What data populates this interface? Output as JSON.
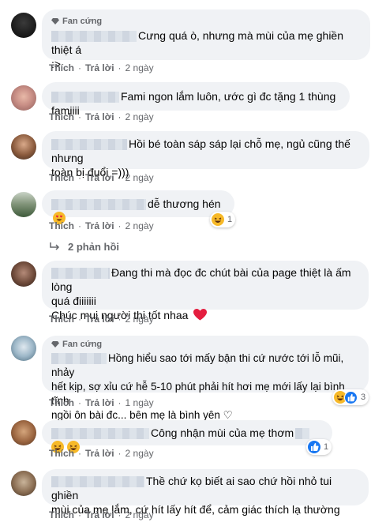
{
  "comments": [
    {
      "badge": "Fan cứng",
      "text_line1": "Cưng quá ò, nhưng mà mùi của mẹ ghiền thiệt á",
      "text_line2": ":>",
      "like": "Thích",
      "reply": "Trả lời",
      "time": "2 ngày"
    },
    {
      "text_line1": "Fami ngon lắm luôn, ước gì đc tặng 1 thùng famiiii",
      "like": "Thích",
      "reply": "Trả lời",
      "time": "2 ngày"
    },
    {
      "text_line1": "Hồi bé toàn sáp sáp lại chỗ mẹ, ngủ cũng thế nhưng",
      "text_line2": "toàn bị đuổi =)))",
      "like": "Thích",
      "reply": "Trả lời",
      "time": "2 ngày"
    },
    {
      "text_line1": "dễ thương hén",
      "like": "Thích",
      "reply": "Trả lời",
      "time": "2 ngày",
      "reaction_count": "1",
      "replies_label": "2 phản hồi"
    },
    {
      "text_line1": "Đang thi mà đọc đc chút bài của page thiệt là ấm lòng",
      "text_line2": "quá điiiiiii",
      "text_line3": "Chúc mụi người thi tốt nhaa",
      "like": "Thích",
      "reply": "Trả lời",
      "time": "2 ngày"
    },
    {
      "badge": "Fan cứng",
      "text_line1": "Hồng hiểu sao tới mấy bận thi cứ nước tới lỗ mũi, nhảy",
      "text_line2": "hết kịp, sợ xỉu cứ hễ 5-10 phút phải hít hơi mẹ mới lấy lại bình tĩnh",
      "text_line3": "ngồi ôn bài đc... bên mẹ là bình yên ♡",
      "like": "Thích",
      "reply": "Trả lời",
      "time": "1 ngày",
      "reaction_count": "3"
    },
    {
      "text_line1": "Công nhận mùi của mẹ thơm",
      "like": "Thích",
      "reply": "Trả lời",
      "time": "2 ngày",
      "reaction_count": "1"
    },
    {
      "text_line1": "Thề chứ kọ biết ai sao chứ hồi nhỏ tui ghiền",
      "text_line2": "mùi của mẹ lắm, cứ hít lấy hít để, cảm giác thích lạ thường",
      "like": "Thích",
      "reply": "Trả lời",
      "time": "2 ngày"
    }
  ],
  "colors": {
    "bubble": "#f0f2f5",
    "meta_text": "#65676b",
    "like_blue": "#1877f2",
    "heart_red": "#e41e3f",
    "haha_yellow": "#f7b928"
  }
}
